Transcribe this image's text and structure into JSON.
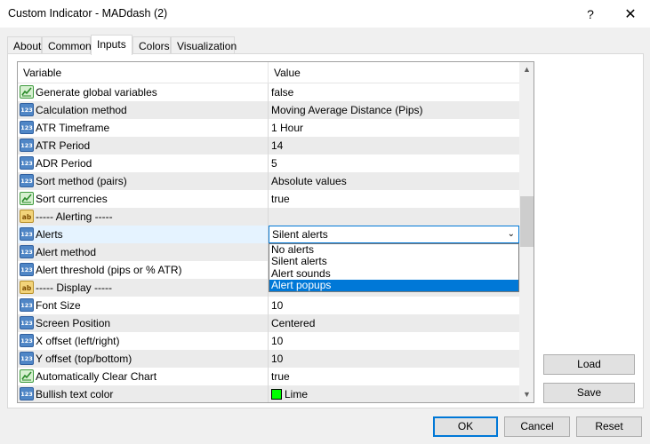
{
  "window": {
    "title": "Custom Indicator - MADdash (2)",
    "help_label": "?",
    "close_label": "✕"
  },
  "tabs": [
    {
      "label": "About"
    },
    {
      "label": "Common"
    },
    {
      "label": "Inputs",
      "active": true
    },
    {
      "label": "Colors"
    },
    {
      "label": "Visualization"
    }
  ],
  "grid": {
    "header": {
      "variable": "Variable",
      "value": "Value"
    },
    "rows": [
      {
        "type": "bool",
        "variable": "Generate global variables",
        "value": "false"
      },
      {
        "type": "num",
        "variable": "Calculation method",
        "value": "Moving Average Distance (Pips)"
      },
      {
        "type": "num",
        "variable": "ATR Timeframe",
        "value": "1 Hour"
      },
      {
        "type": "num",
        "variable": "ATR Period",
        "value": "14"
      },
      {
        "type": "num",
        "variable": "ADR Period",
        "value": "5"
      },
      {
        "type": "num",
        "variable": "Sort method (pairs)",
        "value": "Absolute values"
      },
      {
        "type": "bool",
        "variable": "Sort currencies",
        "value": "true"
      },
      {
        "type": "str",
        "variable": "----- Alerting -----",
        "value": ""
      },
      {
        "type": "num",
        "variable": "Alerts",
        "value": "Silent alerts"
      },
      {
        "type": "num",
        "variable": "Alert method",
        "value": ""
      },
      {
        "type": "num",
        "variable": "Alert threshold (pips or % ATR)",
        "value": ""
      },
      {
        "type": "str",
        "variable": "----- Display -----",
        "value": ""
      },
      {
        "type": "num",
        "variable": "Font Size",
        "value": "10"
      },
      {
        "type": "num",
        "variable": "Screen Position",
        "value": "Centered"
      },
      {
        "type": "num",
        "variable": "X offset (left/right)",
        "value": "10"
      },
      {
        "type": "num",
        "variable": "Y offset (top/bottom)",
        "value": "10"
      },
      {
        "type": "bool",
        "variable": "Automatically Clear Chart",
        "value": "true"
      },
      {
        "type": "num",
        "variable": "Bullish text color",
        "value": "Lime",
        "swatch": "#00ff00"
      }
    ]
  },
  "dropdown": {
    "options": [
      "No alerts",
      "Silent alerts",
      "Alert sounds",
      "Alert popups"
    ],
    "highlighted": "Alert popups"
  },
  "icons": {
    "num": "123",
    "str": "ab"
  },
  "side_buttons": {
    "load": "Load",
    "save": "Save"
  },
  "footer": {
    "ok": "OK",
    "cancel": "Cancel",
    "reset": "Reset"
  },
  "colors": {
    "accent": "#0078d7",
    "selected_row": "#e5f3ff",
    "alt_row": "#ebebeb"
  }
}
